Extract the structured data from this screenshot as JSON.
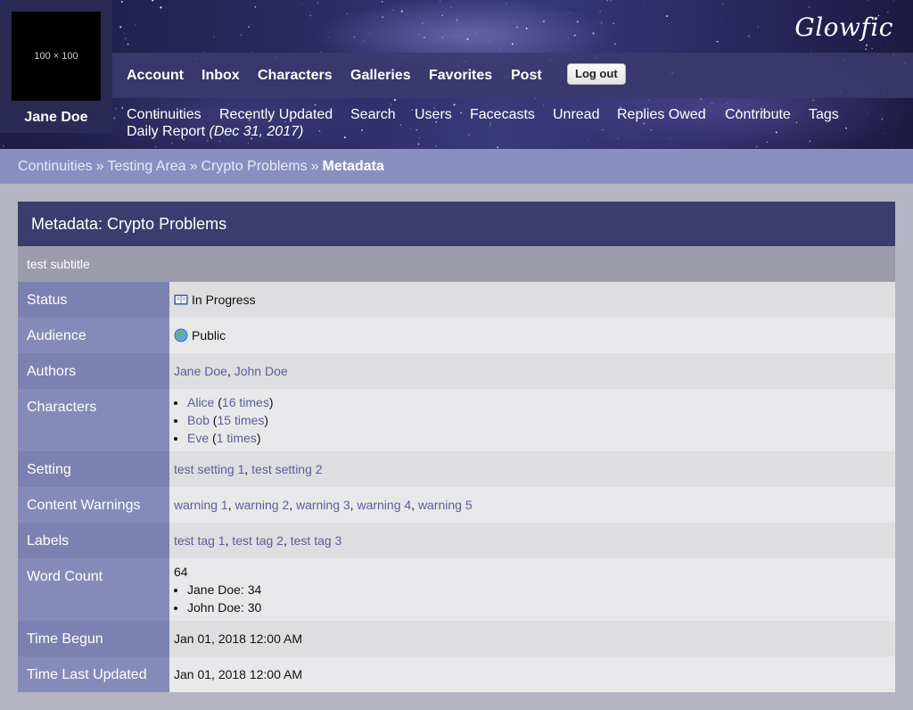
{
  "user": {
    "avatar_placeholder": "100 × 100",
    "name": "Jane Doe"
  },
  "brand": {
    "logo_text": "Glowfic"
  },
  "nav": {
    "main": [
      "Account",
      "Inbox",
      "Characters",
      "Galleries",
      "Favorites",
      "Post"
    ],
    "logout_label": "Log out",
    "sub": [
      "Continuities",
      "Recently Updated",
      "Search",
      "Users",
      "Facecasts",
      "Unread",
      "Replies Owed",
      "Contribute",
      "Tags"
    ],
    "daily_report": {
      "label": "Daily Report",
      "date": "(Dec 31, 2017)"
    }
  },
  "breadcrumb": {
    "items": [
      "Continuities",
      "Testing Area",
      "Crypto Problems"
    ],
    "separator": "»",
    "current": "Metadata"
  },
  "page": {
    "title": "Metadata: Crypto Problems",
    "subtitle": "test subtitle"
  },
  "metadata": {
    "status": {
      "label": "Status",
      "icon": "book-icon",
      "value": "In Progress"
    },
    "audience": {
      "label": "Audience",
      "icon": "globe-icon",
      "value": "Public"
    },
    "authors": {
      "label": "Authors",
      "values": [
        "Jane Doe",
        "John Doe"
      ]
    },
    "characters": {
      "label": "Characters",
      "items": [
        {
          "name": "Alice",
          "count": "16 times"
        },
        {
          "name": "Bob",
          "count": "15 times"
        },
        {
          "name": "Eve",
          "count": "1 times"
        }
      ]
    },
    "setting": {
      "label": "Setting",
      "values": [
        "test setting 1",
        "test setting 2"
      ]
    },
    "warnings": {
      "label": "Content Warnings",
      "values": [
        "warning 1",
        "warning 2",
        "warning 3",
        "warning 4",
        "warning 5"
      ]
    },
    "labels": {
      "label": "Labels",
      "values": [
        "test tag 1",
        "test tag 2",
        "test tag 3"
      ]
    },
    "word_count": {
      "label": "Word Count",
      "total": "64",
      "breakdown": [
        "Jane Doe: 34",
        "John Doe: 30"
      ]
    },
    "time_begun": {
      "label": "Time Begun",
      "value": "Jan 01, 2018 12:00 AM"
    },
    "time_updated": {
      "label": "Time Last Updated",
      "value": "Jan 01, 2018 12:00 AM"
    }
  },
  "colors": {
    "header_bar": "#3d3c6e",
    "label_column": "#8086b4",
    "link": "#5a5e99",
    "breadcrumb_bg": "#8a8fc2"
  }
}
